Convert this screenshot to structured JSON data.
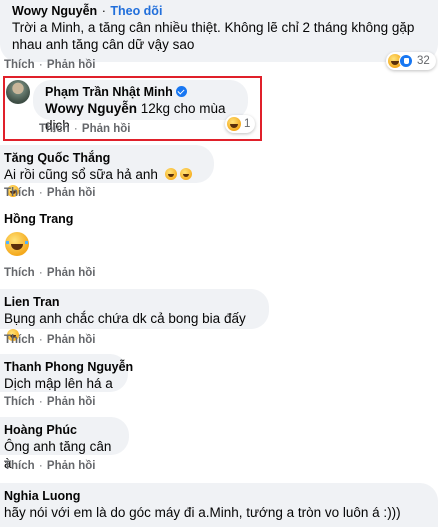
{
  "comments": [
    {
      "author": "Wowy Nguyễn",
      "follow": "Theo dõi",
      "text_line1": "Trời a Minh, a tăng cân nhiều thiệt. Không lẽ chỉ 2 tháng không gặp",
      "text_line2": "nhau anh tăng cân dữ vậy sao",
      "reaction_count": "32",
      "actions": {
        "like": "Thích",
        "reply": "Phản hồi"
      }
    },
    {
      "author": "Phạm Trần Nhật Minh",
      "tag": "Wowy Nguyễn",
      "text": " 12kg cho mùa dịch",
      "reaction_count": "1",
      "actions": {
        "like": "Thích",
        "reply": "Phản hồi"
      }
    },
    {
      "author": "Tăng Quốc Thắng",
      "text": "Ai rồi cũng sổ sữa hả anh",
      "actions": {
        "like": "Thích",
        "reply": "Phản hồi"
      }
    },
    {
      "author": "Hồng Trang",
      "actions": {
        "like": "Thích",
        "reply": "Phản hồi"
      }
    },
    {
      "author": "Lien Tran",
      "text": "Bụng anh chắc chứa dk cả bong bia đấy",
      "actions": {
        "like": "Thích",
        "reply": "Phản hồi"
      }
    },
    {
      "author": "Thanh Phong Nguyễn",
      "text": "Dịch mập lên há a",
      "actions": {
        "like": "Thích",
        "reply": "Phản hồi"
      }
    },
    {
      "author": "Hoàng Phúc",
      "text": "Ông anh tăng cân à",
      "actions": {
        "like": "Thích",
        "reply": "Phản hồi"
      }
    },
    {
      "author": "Nghia Luong",
      "text": "hãy nói với em là do góc máy đi a.Minh, tướng a tròn vo luôn á :)))",
      "actions": {
        "like": "Thích",
        "reply": "Phản hồi"
      }
    }
  ],
  "colors": {
    "bubble": "#f0f2f5",
    "highlight": "#e0202a",
    "link": "#216fdb"
  }
}
